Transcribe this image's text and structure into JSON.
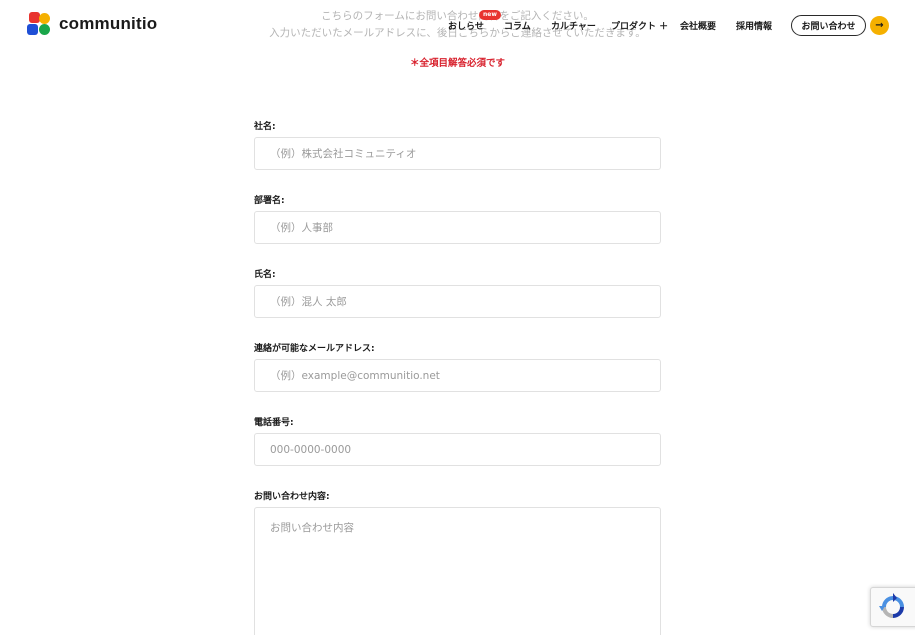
{
  "header": {
    "logo_text": "communitio",
    "nav": [
      {
        "label": "おしらせ",
        "badge": "new"
      },
      {
        "label": "コラム"
      },
      {
        "label": "カルチャー"
      },
      {
        "label": "プロダクト ＋"
      },
      {
        "label": "会社概要"
      },
      {
        "label": "採用情報"
      }
    ],
    "contact_label": "お問い合わせ",
    "arrow_icon": "arrow-right-icon"
  },
  "intro": {
    "line1": "こちらのフォームにお問い合わせ内容をご記入ください。",
    "line2": "入力いただいたメールアドレスに、後日こちらからご連絡させていただきます。",
    "required_note": "＊全項目解答必須です"
  },
  "form": {
    "company": {
      "label": "社名:",
      "placeholder": "（例）株式会社コミュニティオ",
      "value": ""
    },
    "department": {
      "label": "部署名:",
      "placeholder": "（例）人事部",
      "value": ""
    },
    "name": {
      "label": "氏名:",
      "placeholder": "（例）混人 太郎",
      "value": ""
    },
    "email": {
      "label": "連絡が可能なメールアドレス:",
      "placeholder": "（例）example@communitio.net",
      "value": ""
    },
    "phone": {
      "label": "電話番号:",
      "placeholder": "000-0000-0000",
      "value": ""
    },
    "inquiry": {
      "label": "お問い合わせ内容:",
      "placeholder": "お問い合わせ内容",
      "value": ""
    }
  },
  "colors": {
    "accent_yellow": "#f5b000",
    "required_red": "#d8222e",
    "logo_red": "#e8342f",
    "logo_blue": "#1f4fd6",
    "logo_green": "#1aa64a"
  }
}
